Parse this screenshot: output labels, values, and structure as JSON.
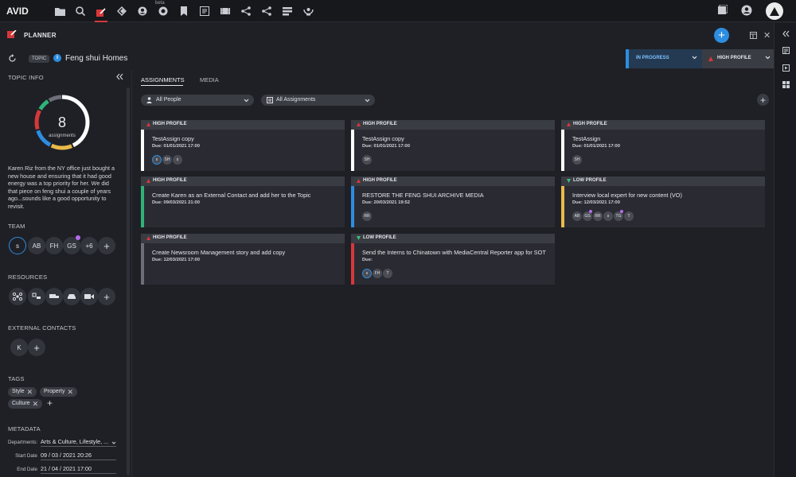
{
  "app": {
    "brand": "AVID",
    "beta_label": "beta",
    "planner_title": "PLANNER"
  },
  "topic": {
    "pill": "TOPIC",
    "info": "i",
    "name": "Feng shui Homes",
    "status": "IN PROGRESS",
    "priority": "HIGH PROFILE"
  },
  "left": {
    "topic_info_title": "TOPIC INFO",
    "assignments_count": "8",
    "assignments_label": "assignments",
    "description": "Karen Riz from the NY office just bought a new house and ensuring that it had good energy was a top priority for her. We did that piece on feng shui a couple of years ago...sounds like a good opportunity to revisit.",
    "team_title": "TEAM",
    "team": [
      "s",
      "AB",
      "FH",
      "GS",
      "+6"
    ],
    "add": "+",
    "resources_title": "RESOURCES",
    "external_title": "EXTERNAL CONTACTS",
    "external": [
      "K"
    ],
    "tags_title": "TAGS",
    "tags": [
      "Style",
      "Property",
      "Culture"
    ],
    "tag_remove": "✕",
    "metadata_title": "METADATA",
    "metadata": {
      "departments_label": "Departments:",
      "departments_value": "Arts & Culture, Lifestyle, ...",
      "start_label": "Start Date",
      "start_value": "09 / 03 / 2021  20:26",
      "end_label": "End Date",
      "end_value": "21 / 04 / 2021  17:00"
    }
  },
  "main": {
    "tabs": [
      "ASSIGNMENTS",
      "MEDIA"
    ],
    "filter_people": "All People",
    "filter_assignments": "All Assignments",
    "add": "+"
  },
  "cards": [
    {
      "priority": "HIGH PROFILE",
      "title": "TestAssign copy",
      "due": "Due: 01/01/2021 17:00",
      "avatars": [
        "s",
        "SH",
        "s"
      ]
    },
    {
      "priority": "HIGH PROFILE",
      "title": "TestAssign copy",
      "due": "Due: 01/01/2021 17:00",
      "avatars": [
        "SH"
      ]
    },
    {
      "priority": "HIGH PROFILE",
      "title": "TestAssign",
      "due": "Due: 01/01/2021 17:00",
      "avatars": [
        "SH"
      ]
    },
    {
      "priority": "HIGH PROFILE",
      "title": "Create Karen as an External Contact and add her to the Topic",
      "due": "Due: 09/03/2021 21:00",
      "avatars": []
    },
    {
      "priority": "HIGH PROFILE",
      "title": "RESTORE THE FENG SHUI ARCHIVE MEDIA",
      "due": "Due: 20/03/2021 19:52",
      "avatars": [
        "RR"
      ]
    },
    {
      "priority": "LOW PROFILE",
      "title": "Interview local expert for new content (VO)",
      "due": "Due: 12/03/2021 17:00",
      "avatars": [
        "AB",
        "GS",
        "RR",
        "s",
        "TG",
        "T"
      ]
    },
    {
      "priority": "HIGH PROFILE",
      "title": "Create Newsroom Management story and add copy",
      "due": "Due: 12/03/2021 17:00",
      "avatars": []
    },
    {
      "priority": "LOW PROFILE",
      "title": "Send the Interns to Chinatown with MediaCentral Reporter app for SOT",
      "due": "Due:",
      "avatars": [
        "s",
        "FH",
        "T"
      ]
    }
  ],
  "colors": {
    "accent": "#2d8de0",
    "high": "#d6383a",
    "low": "#3fc07a",
    "bars": [
      "#ffffff",
      "#ffffff",
      "#ffffff",
      "#2fb37a",
      "#2d8de0",
      "#e9b949",
      "#6d6f78",
      "#d6383a"
    ]
  }
}
